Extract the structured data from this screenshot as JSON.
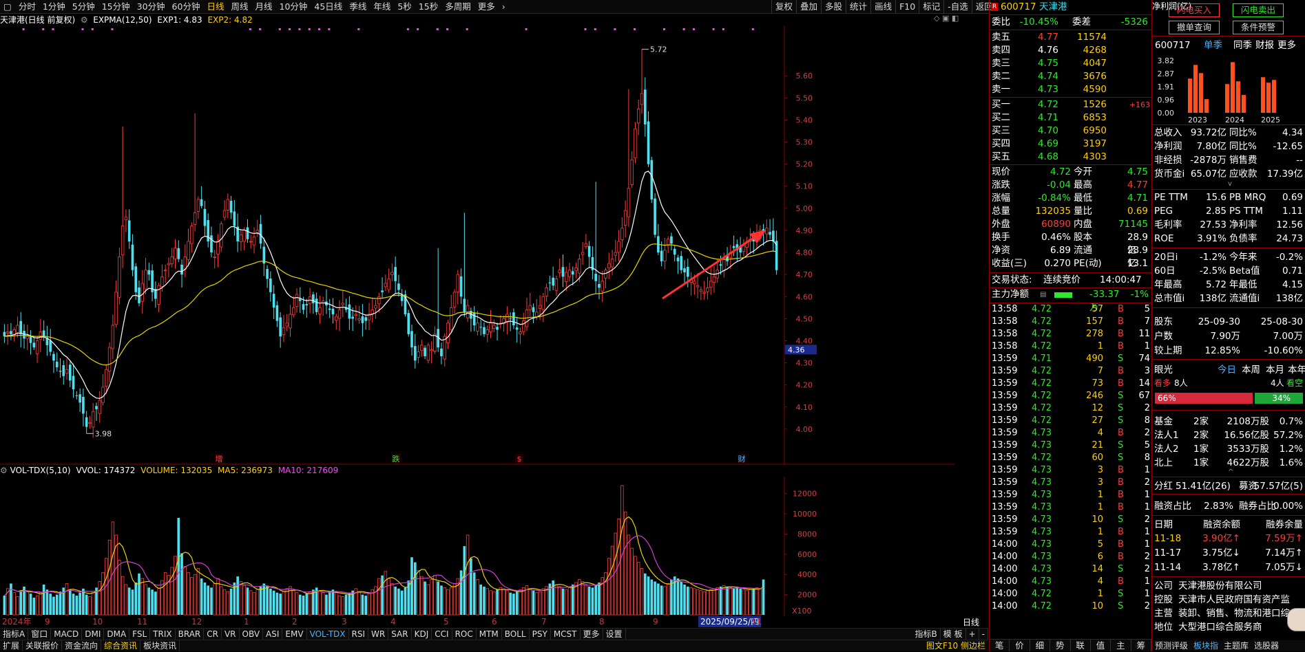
{
  "top_periods": [
    "分时",
    "1分钟",
    "5分钟",
    "15分钟",
    "30分钟",
    "60分钟",
    "日线",
    "周线",
    "月线",
    "10分钟",
    "45日线",
    "季线",
    "年线",
    "5秒",
    "15秒",
    "多周期",
    "更多"
  ],
  "top_right": [
    "复权",
    "叠加",
    "多股",
    "统计",
    "画线",
    "F10",
    "标记",
    "-自选",
    "返回"
  ],
  "head": {
    "name": "天津港(日线 前复权)",
    "exp": "EXPMA(12,50)",
    "exp1": "EXP1: 4.83",
    "exp2": "EXP2: 4.82"
  },
  "vol_head": {
    "name": "VOL-TDX(5,10)",
    "vvol": "VVOL: 174372",
    "volume": "VOLUME: 132035",
    "ma5": "MA5: 236973",
    "ma10": "MA10: 217609"
  },
  "price_axis": [
    "5.60",
    "5.50",
    "5.40",
    "5.30",
    "5.20",
    "5.10",
    "5.00",
    "4.90",
    "4.80",
    "4.70",
    "4.60",
    "4.50",
    "4.40",
    "4.30",
    "4.20",
    "4.10",
    "4.00"
  ],
  "price_tag": "4.36",
  "vol_axis": [
    "12000",
    "10000",
    "8000",
    "6000",
    "4000",
    "2000"
  ],
  "vol_unit": "X100",
  "annot": {
    "high": "5.72",
    "low": "3.98"
  },
  "markers": [
    {
      "t": "增",
      "x": 318
    },
    {
      "t": "跌",
      "x": 575
    },
    {
      "t": "$",
      "x": 754
    },
    {
      "t": "财",
      "x": 1077
    }
  ],
  "date_labels": [
    {
      "t": "2024年",
      "x": 3
    },
    {
      "t": "9",
      "x": 65
    },
    {
      "t": "10",
      "x": 134
    },
    {
      "t": "11",
      "x": 199
    },
    {
      "t": "12",
      "x": 278
    },
    {
      "t": "1",
      "x": 354
    },
    {
      "t": "2",
      "x": 424
    },
    {
      "t": "3",
      "x": 496
    },
    {
      "t": "4",
      "x": 567
    },
    {
      "t": "5",
      "x": 644
    },
    {
      "t": "6",
      "x": 714
    },
    {
      "t": "7",
      "x": 786
    },
    {
      "t": "8",
      "x": 870
    },
    {
      "t": "9",
      "x": 948
    },
    {
      "t": "2025/09/25/四",
      "x": 1014
    },
    {
      "t": "11",
      "x": 1091
    }
  ],
  "date_right": "日线",
  "tabs1": [
    "指标A",
    "窗口",
    "MACD",
    "DMI",
    "DMA",
    "FSL",
    "TRIX",
    "BRAR",
    "CR",
    "VR",
    "OBV",
    "ASI",
    "EMV",
    "VOL-TDX",
    "RSI",
    "WR",
    "SAR",
    "KDJ",
    "CCI",
    "ROC",
    "MTM",
    "BOLL",
    "PSY",
    "MCST",
    "更多",
    "设置"
  ],
  "tabs1_right": [
    "指标B",
    "模 板",
    "+",
    "-"
  ],
  "tabs2": [
    "扩展",
    "关联报价",
    "资金流向",
    "综合资讯",
    "板块资讯"
  ],
  "tabs2_right": "图文F10 侧边栏",
  "quote": {
    "code": "600717",
    "name": "天津港",
    "badge": "R",
    "weibi_label": "委比",
    "weibi": "-10.45%",
    "weicha_label": "委差",
    "weicha": "-5326",
    "sells": [
      {
        "l": "卖五",
        "p": "4.77",
        "v": "11574"
      },
      {
        "l": "卖四",
        "p": "4.76",
        "v": "4268"
      },
      {
        "l": "卖三",
        "p": "4.75",
        "v": "4047"
      },
      {
        "l": "卖二",
        "p": "4.74",
        "v": "3676"
      },
      {
        "l": "卖一",
        "p": "4.73",
        "v": "4590"
      }
    ],
    "buys": [
      {
        "l": "买一",
        "p": "4.72",
        "v": "1526",
        "d": "+163"
      },
      {
        "l": "买二",
        "p": "4.71",
        "v": "6853",
        "d": ""
      },
      {
        "l": "买三",
        "p": "4.70",
        "v": "6950",
        "d": ""
      },
      {
        "l": "买四",
        "p": "4.69",
        "v": "3197",
        "d": ""
      },
      {
        "l": "买五",
        "p": "4.68",
        "v": "4303",
        "d": ""
      }
    ],
    "stats": [
      {
        "a": "现价",
        "b": "4.72",
        "c": "今开",
        "d": "4.75"
      },
      {
        "a": "涨跌",
        "b": "-0.04",
        "c": "最高",
        "d": "4.77"
      },
      {
        "a": "涨幅",
        "b": "-0.84%",
        "c": "最低",
        "d": "4.71"
      },
      {
        "a": "总量",
        "b": "132035",
        "c": "量比",
        "d": "0.69"
      },
      {
        "a": "外盘",
        "b": "60890",
        "c": "内盘",
        "d": "71145"
      },
      {
        "a": "换手",
        "b": "0.46%",
        "c": "股本",
        "d": "28.9亿"
      },
      {
        "a": "净资",
        "b": "6.89",
        "c": "流通",
        "d": "28.9亿"
      },
      {
        "a": "收益(三)",
        "b": "0.270",
        "c": "PE(动)",
        "d": "13.1"
      }
    ],
    "status_label": "交易状态:",
    "status": "连续竞价",
    "status_time": "14:00:47",
    "flow_label": "主力净额",
    "flow": "-33.37万",
    "flow_pct": "-1%",
    "ticks": [
      [
        "13:58",
        "4.72",
        "57",
        "B",
        "5"
      ],
      [
        "13:58",
        "4.72",
        "157",
        "B",
        "7"
      ],
      [
        "13:58",
        "4.72",
        "278",
        "B",
        "11"
      ],
      [
        "13:58",
        "4.72",
        "1",
        "B",
        "1"
      ],
      [
        "13:59",
        "4.71",
        "490",
        "S",
        "74"
      ],
      [
        "13:59",
        "4.72",
        "7",
        "B",
        "3"
      ],
      [
        "13:59",
        "4.72",
        "73",
        "B",
        "14"
      ],
      [
        "13:59",
        "4.72",
        "246",
        "S",
        "67"
      ],
      [
        "13:59",
        "4.72",
        "12",
        "S",
        "2"
      ],
      [
        "13:59",
        "4.72",
        "27",
        "S",
        "8"
      ],
      [
        "13:59",
        "4.73",
        "4",
        "B",
        "2"
      ],
      [
        "13:59",
        "4.73",
        "21",
        "S",
        "5"
      ],
      [
        "13:59",
        "4.72",
        "60",
        "S",
        "8"
      ],
      [
        "13:59",
        "4.73",
        "3",
        "B",
        "1"
      ],
      [
        "13:59",
        "4.73",
        "3",
        "B",
        "2"
      ],
      [
        "13:59",
        "4.73",
        "1",
        "B",
        "1"
      ],
      [
        "13:59",
        "4.73",
        "1",
        "B",
        "1"
      ],
      [
        "13:59",
        "4.73",
        "10",
        "S",
        "2"
      ],
      [
        "13:59",
        "4.73",
        "1",
        "B",
        "1"
      ],
      [
        "14:00",
        "4.73",
        "5",
        "B",
        "1"
      ],
      [
        "14:00",
        "4.73",
        "6",
        "B",
        "2"
      ],
      [
        "14:00",
        "4.73",
        "14",
        "S",
        "2"
      ],
      [
        "14:00",
        "4.73",
        "4",
        "B",
        "1"
      ],
      [
        "14:00",
        "4.72",
        "1",
        "S",
        "1"
      ],
      [
        "14:00",
        "4.72",
        "10",
        "S",
        "2"
      ]
    ],
    "bottom_tabs": [
      "笔",
      "价",
      "细",
      "势",
      "联",
      "值",
      "主",
      "筹"
    ]
  },
  "fund": {
    "btn_buy": "闪电买入",
    "btn_sell": "闪电卖出",
    "btn_order": "撤单查询",
    "btn_cond": "条件预警",
    "code": "600717",
    "tabs": [
      "单季",
      "同季",
      "财报",
      "更多"
    ],
    "chart_title": "净利润(亿)",
    "yaxis": [
      "3.82",
      "2.87",
      "1.91",
      "0.96",
      "0.00"
    ],
    "years": [
      "2023",
      "2024",
      "2025"
    ],
    "bars": [
      {
        "year": "2023",
        "values": [
          2.5,
          3.5,
          2.9,
          1.0
        ]
      },
      {
        "year": "2024",
        "values": [
          2.1,
          3.7,
          2.3,
          1.3
        ]
      },
      {
        "year": "2025",
        "values": [
          2.6,
          2.2,
          2.4
        ]
      }
    ],
    "fin": [
      {
        "a": "总收入",
        "b": "93.72亿",
        "c": "同比%",
        "d": "4.34"
      },
      {
        "a": "净利润",
        "b": "7.80亿",
        "c": "同比%",
        "d": "-12.65"
      },
      {
        "a": "非经损",
        "b": "-2878万",
        "c": "销售费",
        "d": "--"
      },
      {
        "a": "货币金i",
        "b": "65.07亿",
        "c": "应收款",
        "d": "17.39亿"
      }
    ],
    "val": [
      {
        "a": "PE TTM",
        "b": "15.6",
        "c": "PB MRQ",
        "d": "0.69"
      },
      {
        "a": "PEG",
        "b": "2.85",
        "c": "PS TTM",
        "d": "1.11"
      },
      {
        "a": "毛利率",
        "b": "27.53",
        "c": "净利率",
        "d": "12.56"
      },
      {
        "a": "ROE",
        "b": "3.91%",
        "c": "负债率",
        "d": "24.73"
      }
    ],
    "perf": [
      {
        "a": "20日i",
        "b": "-1.2%",
        "c": "今年来",
        "d": "-0.2%"
      },
      {
        "a": "60日",
        "b": "-2.5%",
        "c": "Beta值",
        "d": "0.71"
      },
      {
        "a": "年最高",
        "b": "5.72",
        "c": "年最低",
        "d": "4.15"
      },
      {
        "a": "总市值i",
        "b": "138亿",
        "c": "流通值i",
        "d": "138亿"
      }
    ],
    "holders": [
      {
        "a": "股东",
        "b": "25-09-30",
        "d": "25-08-30"
      },
      {
        "a": "户数",
        "b": "7.90万",
        "d": "7.00万"
      },
      {
        "a": "较上期",
        "b": "12.85%",
        "d": "-10.60%"
      }
    ],
    "eye_label": "眼光",
    "eye_tabs": [
      "今日",
      "本周",
      "本月",
      "本年"
    ],
    "bull_label": "看多",
    "bull_n": "8人",
    "bear_n": "4人",
    "bear_label": "看空",
    "bull_pct": "66%",
    "bear_pct": "34%",
    "inst": [
      {
        "a": "基金",
        "b": "2家",
        "c": "2108万股",
        "d": "0.7%"
      },
      {
        "a": "法人1",
        "b": "2家",
        "c": "16.56亿股",
        "d": "57.2%"
      },
      {
        "a": "法人2",
        "b": "1家",
        "c": "3533万股",
        "d": "1.2%"
      },
      {
        "a": "北上",
        "b": "1家",
        "c": "4622万股",
        "d": "1.6%"
      }
    ],
    "div_label": "分红",
    "div_val": "51.41亿(26)",
    "raise_label": "募资",
    "raise_val": "57.57亿(5)",
    "margin_label": "融资占比",
    "margin_val": "2.83%",
    "short_label": "融券占比",
    "short_val": "0.00%",
    "mhead": [
      "日期",
      "融资余额",
      "融券余量"
    ],
    "mrows": [
      [
        "11-18",
        "3.90亿↑",
        "7.59万↑"
      ],
      [
        "11-17",
        "3.75亿↓",
        "7.14万↑"
      ],
      [
        "11-14",
        "3.78亿↑",
        "7.05万↓"
      ]
    ],
    "company": [
      {
        "a": "公司",
        "b": "天津港股份有限公司"
      },
      {
        "a": "控股",
        "b": "天津市人民政府国有资产监"
      },
      {
        "a": "主营",
        "b": "装卸、销售、物流和港口综"
      },
      {
        "a": "地位",
        "b": "大型港口综合服务商"
      }
    ],
    "bottom": [
      "预测评级",
      "板块指",
      "主题库",
      "选股器"
    ]
  },
  "colors": {
    "up": "#ff3c3c",
    "down": "#4fe0f0",
    "exp1": "#ffffff",
    "exp2": "#e6d400",
    "ma10": "#d040d0",
    "arrow": "#ff3333"
  },
  "chart_data": {
    "type": "candlestick",
    "title": "天津港(日线 前复权)",
    "start_date": "2024-08-01",
    "y_range": [
      3.9,
      5.8
    ],
    "annotations": {
      "high": 5.72,
      "low": 3.98
    },
    "closes": [
      4.42,
      4.44,
      4.43,
      4.45,
      4.47,
      4.43,
      4.41,
      4.42,
      4.39,
      4.37,
      4.4,
      4.44,
      4.42,
      4.38,
      4.35,
      4.31,
      4.28,
      4.26,
      4.24,
      4.27,
      4.22,
      4.18,
      4.15,
      4.12,
      4.07,
      4.01,
      4.03,
      4.08,
      4.09,
      4.13,
      4.19,
      4.27,
      4.37,
      4.47,
      4.62,
      4.78,
      4.92,
      4.96,
      4.85,
      4.72,
      4.62,
      4.57,
      4.66,
      4.72,
      4.7,
      4.62,
      4.59,
      4.65,
      4.69,
      4.72,
      4.75,
      4.78,
      4.82,
      4.77,
      4.7,
      4.78,
      4.85,
      4.92,
      4.98,
      5.04,
      5.01,
      4.92,
      4.85,
      4.8,
      4.78,
      4.85,
      4.93,
      4.99,
      5.04,
      4.98,
      4.92,
      4.85,
      4.88,
      4.9,
      4.86,
      4.85,
      4.87,
      4.9,
      4.84,
      4.75,
      4.68,
      4.62,
      4.55,
      4.49,
      4.42,
      4.46,
      4.48,
      4.52,
      4.55,
      4.61,
      4.58,
      4.54,
      4.56,
      4.6,
      4.57,
      4.53,
      4.55,
      4.58,
      4.56,
      4.54,
      4.52,
      4.51,
      4.54,
      4.57,
      4.54,
      4.5,
      4.5,
      4.52,
      4.5,
      4.48,
      4.49,
      4.52,
      4.54,
      4.56,
      4.6,
      4.62,
      4.66,
      4.68,
      4.71,
      4.67,
      4.63,
      4.58,
      4.52,
      4.43,
      4.37,
      4.31,
      4.35,
      4.38,
      4.33,
      4.38,
      4.36,
      4.43,
      4.37,
      4.33,
      4.42,
      4.48,
      4.55,
      4.62,
      4.7,
      4.6,
      4.53,
      4.56,
      4.5,
      4.47,
      4.48,
      4.46,
      4.43,
      4.45,
      4.48,
      4.47,
      4.45,
      4.48,
      4.5,
      4.52,
      4.5,
      4.47,
      4.45,
      4.44,
      4.49,
      4.54,
      4.56,
      4.53,
      4.53,
      4.56,
      4.6,
      4.64,
      4.66,
      4.65,
      4.68,
      4.72,
      4.69,
      4.71,
      4.72,
      4.7,
      4.73,
      4.77,
      4.8,
      4.84,
      4.78,
      4.72,
      4.67,
      4.64,
      4.67,
      4.72,
      4.75,
      4.77,
      4.8,
      4.85,
      4.91,
      4.99,
      5.09,
      5.22,
      5.36,
      5.45,
      5.52,
      5.38,
      5.2,
      5.04,
      4.88,
      4.8,
      4.76,
      4.81,
      4.86,
      4.84,
      4.79,
      4.76,
      4.72,
      4.71,
      4.69,
      4.68,
      4.67,
      4.65,
      4.63,
      4.62,
      4.64,
      4.67,
      4.69,
      4.72,
      4.74,
      4.77,
      4.76,
      4.8,
      4.82,
      4.81,
      4.8,
      4.83,
      4.85,
      4.86,
      4.85,
      4.88,
      4.9,
      4.89,
      4.91,
      4.88,
      4.85,
      4.72
    ],
    "volumes": [
      1900,
      2600,
      3100,
      2200,
      1800,
      2300,
      2800,
      2400,
      2100,
      1700,
      1900,
      2200,
      3000,
      2500,
      2100,
      1800,
      2000,
      2300,
      2700,
      3100,
      2500,
      2100,
      1900,
      2200,
      2600,
      2000,
      1800,
      2300,
      2700,
      3300,
      4200,
      5600,
      7400,
      9200,
      7900,
      5400,
      3800,
      3000,
      2700,
      2500,
      3200,
      4100,
      3600,
      3000,
      2700,
      2500,
      2300,
      2600,
      3400,
      4200,
      3900,
      4700,
      5800,
      9600,
      6100,
      4800,
      4200,
      3700,
      4000,
      4600,
      3600,
      3200,
      2900,
      2700,
      3100,
      3600,
      2800,
      2500,
      2300,
      2600,
      3200,
      3800,
      3300,
      2900,
      2700,
      2400,
      2200,
      2500,
      2800,
      3100,
      2900,
      2600,
      2400,
      2200,
      2100,
      2300,
      2600,
      2800,
      2400,
      2200,
      2000,
      1900,
      2100,
      2300,
      2500,
      2700,
      2400,
      2200,
      2000,
      2300,
      2500,
      2200,
      1900,
      1800,
      2000,
      2200,
      2400,
      2600,
      2300,
      2000,
      1900,
      2100,
      2500,
      2800,
      3600,
      3900,
      4300,
      3600,
      3100,
      2800,
      2600,
      2400,
      2700,
      3400,
      5700,
      5200,
      4400,
      3800,
      3300,
      3000,
      3500,
      3900,
      3300,
      2900,
      2700,
      2500,
      2700,
      3100,
      3600,
      4400,
      6800,
      7900,
      5600,
      4200,
      3500,
      3000,
      2800,
      2600,
      2400,
      2300,
      2500,
      2700,
      2600,
      2400,
      2200,
      2100,
      2300,
      2500,
      2700,
      2900,
      2600,
      2400,
      2200,
      2300,
      2600,
      2800,
      3100,
      3400,
      3000,
      2800,
      2600,
      2500,
      2700,
      3000,
      3200,
      3500,
      3300,
      3000,
      2800,
      2700,
      2900,
      3200,
      3700,
      4200,
      5600,
      6800,
      8100,
      9500,
      12800,
      10200,
      7900,
      6600,
      5800,
      5200,
      4600,
      4100,
      3800,
      3500,
      3300,
      3100,
      2900,
      2800,
      3100,
      3500,
      3800,
      3600,
      3300,
      3000,
      2800,
      2700,
      2600,
      2500,
      2400,
      2300,
      2400,
      2500,
      2600,
      2700,
      2800,
      2900,
      2800,
      2700,
      2600,
      2700,
      2600,
      2500,
      2400,
      2500,
      2600,
      2700,
      2600,
      3500
    ],
    "y_axis_volume": [
      0,
      13000
    ],
    "legend": [
      "EXP1",
      "EXP2",
      "MA5",
      "MA10"
    ]
  }
}
